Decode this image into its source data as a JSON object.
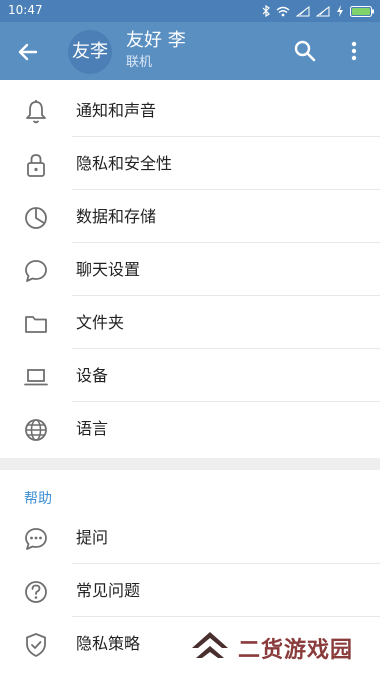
{
  "status_bar": {
    "time": "10:47"
  },
  "header": {
    "avatar_text": "友李",
    "name": "友好 李",
    "status": "联机"
  },
  "settings_items": [
    {
      "label": "通知和声音",
      "icon": "bell-icon"
    },
    {
      "label": "隐私和安全性",
      "icon": "lock-icon"
    },
    {
      "label": "数据和存储",
      "icon": "pie-chart-icon"
    },
    {
      "label": "聊天设置",
      "icon": "chat-bubble-icon"
    },
    {
      "label": "文件夹",
      "icon": "folder-icon"
    },
    {
      "label": "设备",
      "icon": "laptop-icon"
    },
    {
      "label": "语言",
      "icon": "globe-icon"
    }
  ],
  "help_section": {
    "title": "帮助",
    "items": [
      {
        "label": "提问",
        "icon": "chat-dots-icon"
      },
      {
        "label": "常见问题",
        "icon": "question-icon"
      },
      {
        "label": "隐私策略",
        "icon": "shield-check-icon"
      }
    ]
  },
  "watermark": {
    "text": "二货游戏园"
  },
  "colors": {
    "header_bg": "#5a8fc2",
    "status_bg": "#4a80b7",
    "accent": "#3e8fd5",
    "icon_gray": "#6f6f6f"
  }
}
